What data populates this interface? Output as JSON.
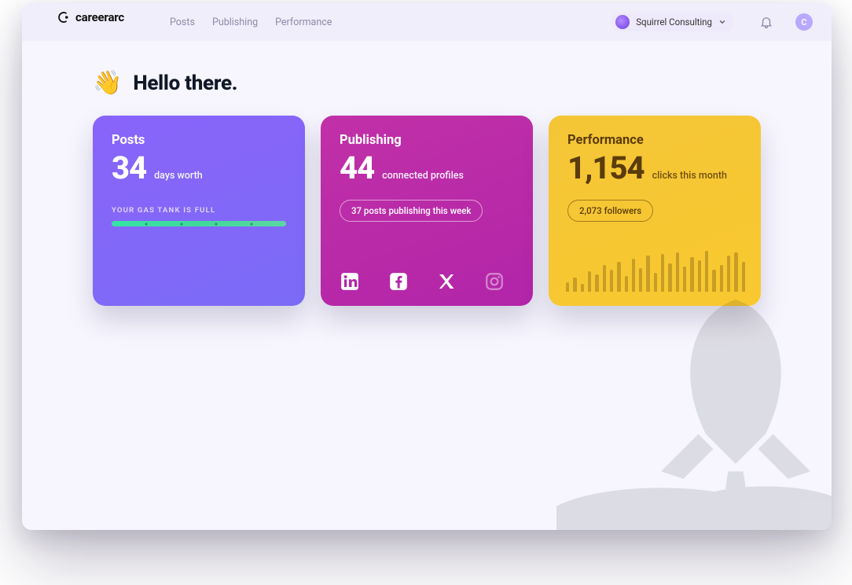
{
  "brand": {
    "name": "careerarc"
  },
  "nav": {
    "items": [
      {
        "label": "Posts"
      },
      {
        "label": "Publishing"
      },
      {
        "label": "Performance"
      }
    ]
  },
  "header": {
    "org_name": "Squirrel Consulting",
    "avatar_initial": "C"
  },
  "hero": {
    "wave_emoji": "👋",
    "title": "Hello there."
  },
  "cards": {
    "posts": {
      "title": "Posts",
      "value": "34",
      "unit": "days worth",
      "gauge_label": "YOUR GAS TANK IS FULL"
    },
    "publishing": {
      "title": "Publishing",
      "value": "44",
      "unit": "connected profiles",
      "pill": "37 posts publishing this week",
      "socials": [
        {
          "name": "linkedin",
          "active": true
        },
        {
          "name": "facebook",
          "active": true
        },
        {
          "name": "x",
          "active": true
        },
        {
          "name": "instagram",
          "active": false
        }
      ]
    },
    "performance": {
      "title": "Performance",
      "value": "1,154",
      "unit": "clicks this month",
      "pill": "2,073 followers"
    }
  },
  "chart_data": {
    "type": "bar",
    "title": "Clicks sparkline",
    "categories": [],
    "values": [
      12,
      18,
      10,
      26,
      22,
      34,
      28,
      38,
      20,
      42,
      30,
      46,
      24,
      48,
      36,
      50,
      32,
      44,
      40,
      52,
      28,
      34,
      46,
      50,
      38
    ],
    "ylim": [
      0,
      52
    ],
    "note": "values are relative bar heights estimated from watermark bars on the Performance card"
  }
}
